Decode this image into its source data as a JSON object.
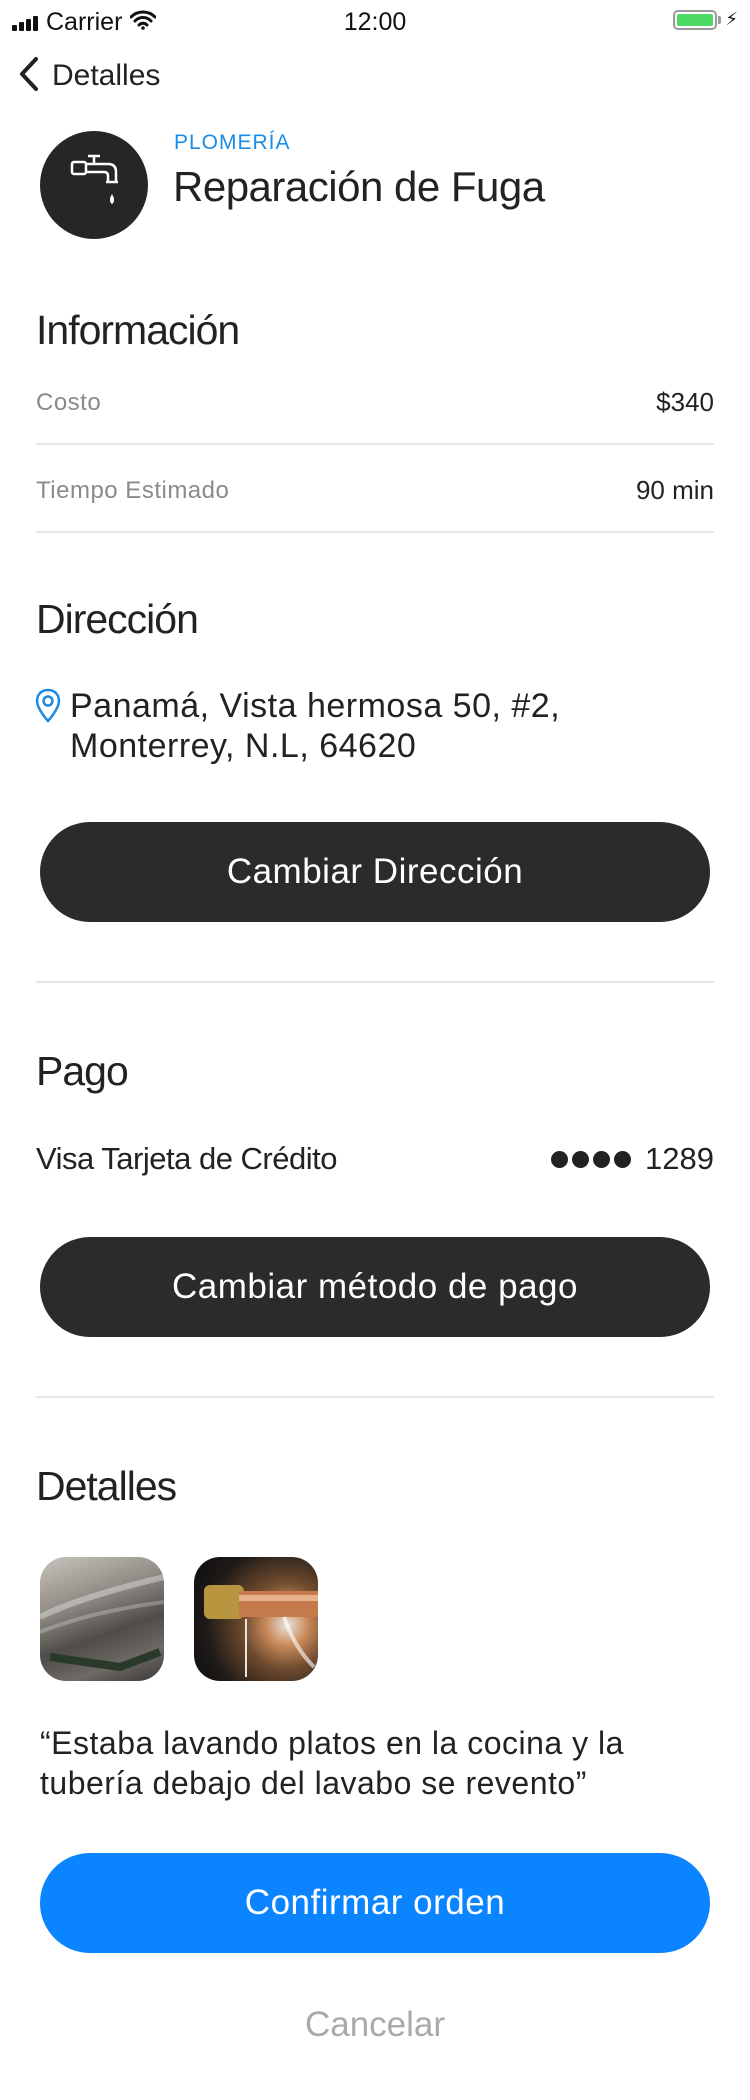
{
  "status_bar": {
    "carrier": "Carrier",
    "time": "12:00"
  },
  "nav": {
    "back_label": "Detalles"
  },
  "header": {
    "category": "PLOMERÍA",
    "title": "Reparación de Fuga",
    "icon": "faucet-icon"
  },
  "info": {
    "title": "Información",
    "rows": [
      {
        "label": "Costo",
        "value": "$340"
      },
      {
        "label": "Tiempo Estimado",
        "value": "90 min"
      }
    ]
  },
  "address": {
    "title": "Dirección",
    "line1": "Panamá, Vista hermosa 50, #2,",
    "line2": "Monterrey, N.L, 64620",
    "change_button": "Cambiar Dirección"
  },
  "payment": {
    "title": "Pago",
    "method": "Visa Tarjeta de Crédito",
    "last4": "1289",
    "change_button": "Cambiar método de pago"
  },
  "details": {
    "title": "Detalles",
    "description": "“Estaba lavando platos en la cocina y la tubería debajo del lavabo se revento”"
  },
  "actions": {
    "confirm": "Confirmar orden",
    "cancel": "Cancelar"
  },
  "colors": {
    "accent": "#0a84ff",
    "category": "#1a8be6",
    "dark_button": "#2b2b2b",
    "battery": "#4cd964"
  }
}
